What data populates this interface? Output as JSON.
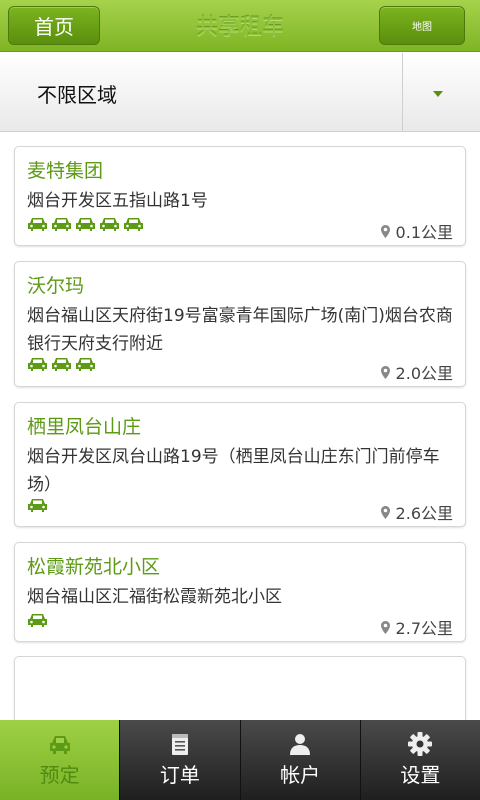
{
  "header": {
    "home_label": "首页",
    "title": "共享租车",
    "map_label": "地图"
  },
  "region": {
    "selected": "不限区域"
  },
  "accent": "#5d9a16",
  "locations": [
    {
      "name": "麦特集团",
      "address": "烟台开发区五指山路1号",
      "cars": 5,
      "distance": "0.1公里"
    },
    {
      "name": "沃尔玛",
      "address": "烟台福山区天府街19号富豪青年国际广场(南门)烟台农商银行天府支行附近",
      "cars": 3,
      "distance": "2.0公里"
    },
    {
      "name": "栖里凤台山庄",
      "address": "烟台开发区凤台山路19号（栖里凤台山庄东门门前停车场）",
      "cars": 1,
      "distance": "2.6公里"
    },
    {
      "name": "松霞新苑北小区",
      "address": "烟台福山区汇福街松霞新苑北小区",
      "cars": 1,
      "distance": "2.7公里"
    }
  ],
  "tabs": [
    {
      "label": "预定",
      "icon": "car-icon"
    },
    {
      "label": "订单",
      "icon": "notepad-icon"
    },
    {
      "label": "帐户",
      "icon": "user-icon"
    },
    {
      "label": "设置",
      "icon": "gear-icon"
    }
  ]
}
